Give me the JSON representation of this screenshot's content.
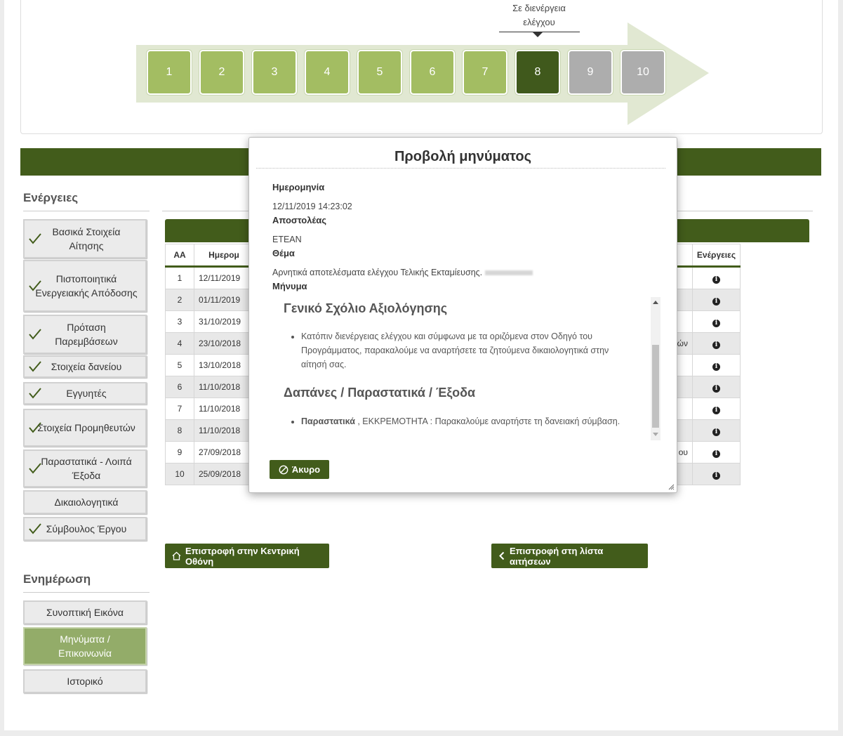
{
  "progress": {
    "steps": [
      {
        "label": "1",
        "state": "done"
      },
      {
        "label": "2",
        "state": "done"
      },
      {
        "label": "3",
        "state": "done"
      },
      {
        "label": "4",
        "state": "done"
      },
      {
        "label": "5",
        "state": "done"
      },
      {
        "label": "6",
        "state": "done"
      },
      {
        "label": "7",
        "state": "done"
      },
      {
        "label": "8",
        "state": "current"
      },
      {
        "label": "9",
        "state": "todo"
      },
      {
        "label": "10",
        "state": "todo"
      }
    ],
    "current_caption_line1": "Σε διενέργεια",
    "current_caption_line2": "ελέγχου"
  },
  "sidebar": {
    "actions_title": "Ενέργειες",
    "actions": [
      {
        "label": "Βασικά Στοιχεία Αίτησης",
        "checked": true
      },
      {
        "label": "Πιστοποιητικά Ενεργειακής Απόδοσης",
        "checked": true
      },
      {
        "label": "Πρόταση Παρεμβάσεων",
        "checked": true
      },
      {
        "label": "Στοιχεία δανείου",
        "checked": true
      },
      {
        "label": "Εγγυητές",
        "checked": true
      },
      {
        "label": "Στοιχεία Προμηθευτών",
        "checked": true
      },
      {
        "label": "Παραστατικά - Λοιπά Έξοδα",
        "checked": true
      },
      {
        "label": "Δικαιολογητικά",
        "checked": false
      },
      {
        "label": "Σύμβουλος Έργου",
        "checked": true
      }
    ],
    "info_title": "Ενημέρωση",
    "info": [
      {
        "label": "Συνοπτική Εικόνα",
        "active": false
      },
      {
        "label": "Μηνύματα / Επικοινωνία",
        "active": true
      },
      {
        "label": "Ιστορικό",
        "active": false
      }
    ]
  },
  "table": {
    "headers": {
      "aa": "ΑΑ",
      "date": "Ημερομ",
      "actions": "Ενέργειες"
    },
    "rows": [
      {
        "aa": "1",
        "date": "12/11/2019",
        "mid": ""
      },
      {
        "aa": "2",
        "date": "01/11/2019",
        "mid": ""
      },
      {
        "aa": "3",
        "date": "31/10/2019",
        "mid": ""
      },
      {
        "aa": "4",
        "date": "23/10/2018",
        "mid": "τών"
      },
      {
        "aa": "5",
        "date": "13/10/2018",
        "mid": ""
      },
      {
        "aa": "6",
        "date": "11/10/2018",
        "mid": ""
      },
      {
        "aa": "7",
        "date": "11/10/2018",
        "mid": ""
      },
      {
        "aa": "8",
        "date": "11/10/2018",
        "mid": ""
      },
      {
        "aa": "9",
        "date": "27/09/2018",
        "mid": "ου"
      },
      {
        "aa": "10",
        "date": "25/09/2018",
        "mid": ""
      }
    ]
  },
  "nav": {
    "home_label": "Επιστροφή στην Κεντρική Οθόνη",
    "list_label": "Επιστροφή στη λίστα αιτήσεων"
  },
  "modal": {
    "title": "Προβολή μηνύματος",
    "date_label": "Ημερομηνία",
    "date_value": "12/11/2019 14:23:02",
    "sender_label": "Αποστολέας",
    "sender_value": "ETEAN",
    "subject_label": "Θέμα",
    "subject_value": "Αρνητικά αποτελέσματα ελέγχου Τελικής Εκταμίευσης.",
    "message_label": "Μήνυμα",
    "section1_title": "Γενικό Σχόλιο Αξιολόγησης",
    "section1_item": "Κατόπιν διενέργειας ελέγχου και σύμφωνα με τα οριζόμενα στον Οδηγό του Προγράμματος, παρακαλούμε να αναρτήσετε τα ζητούμενα δικαιολογητικά στην αίτησή σας.",
    "section2_title": "Δαπάνες / Παραστατικά / Έξοδα",
    "section2_item_bold": "Παραστατικά",
    "section2_item_rest": " , ΕΚΚΡΕΜΟΤΗΤΑ : Παρακαλούμε αναρτήστε τη δανειακή σύμβαση.",
    "cancel_label": "Άκυρο"
  },
  "colors": {
    "primary_green": "#425c1b",
    "done_green": "#a3bd62",
    "todo_gray": "#adadad",
    "active_side": "#93ac69"
  }
}
